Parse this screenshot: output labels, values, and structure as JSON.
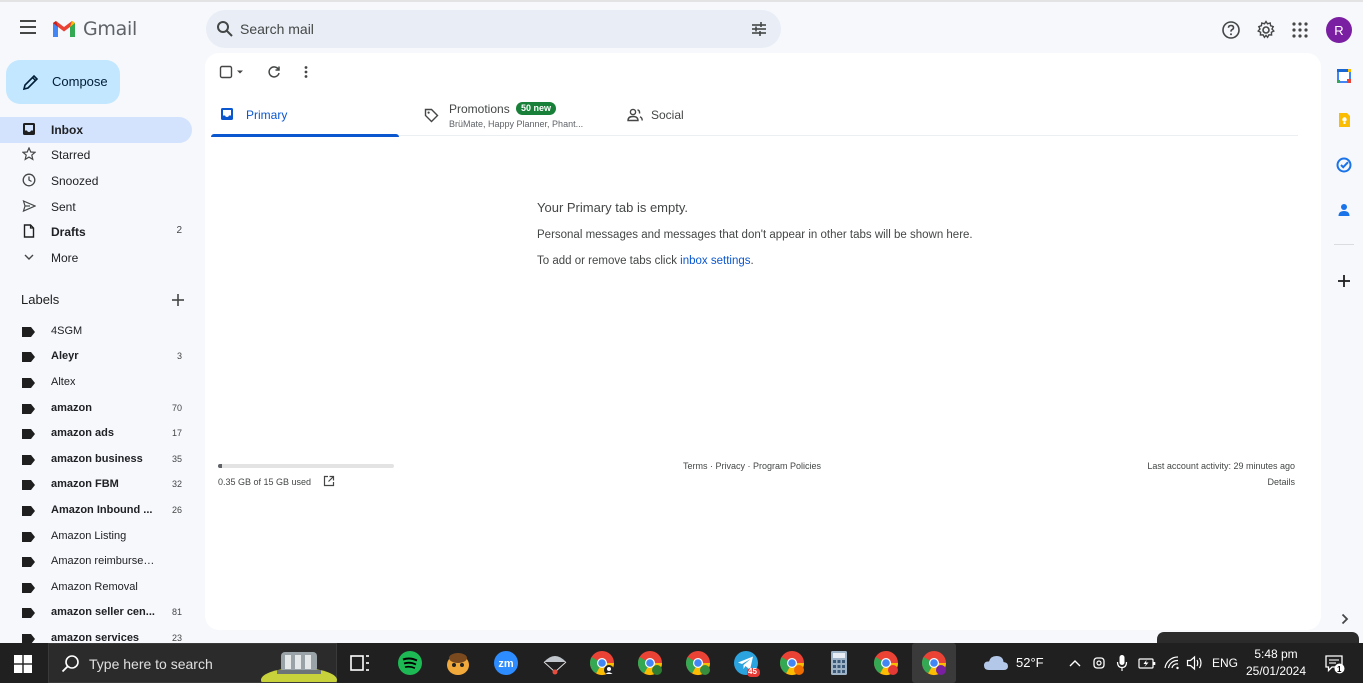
{
  "app": {
    "name": "Gmail",
    "avatar_letter": "R",
    "brand_colors": [
      "#ea4335",
      "#4285f4",
      "#34a853",
      "#fbbc04"
    ]
  },
  "search": {
    "placeholder": "Search mail"
  },
  "compose": {
    "label": "Compose"
  },
  "nav": [
    {
      "label": "Inbox",
      "count": "",
      "icon": "inbox-icon",
      "active": true,
      "bold": true
    },
    {
      "label": "Starred",
      "count": "",
      "icon": "star-icon",
      "active": false,
      "bold": false
    },
    {
      "label": "Snoozed",
      "count": "",
      "icon": "clock-icon",
      "active": false,
      "bold": false
    },
    {
      "label": "Sent",
      "count": "",
      "icon": "send-icon",
      "active": false,
      "bold": false
    },
    {
      "label": "Drafts",
      "count": "2",
      "icon": "draft-icon",
      "active": false,
      "bold": true
    },
    {
      "label": "More",
      "count": "",
      "icon": "chevron-down-icon",
      "active": false,
      "bold": false
    }
  ],
  "labels": {
    "header": "Labels",
    "items": [
      {
        "label": "4SGM",
        "count": "",
        "bold": false
      },
      {
        "label": "Aleyr",
        "count": "3",
        "bold": true
      },
      {
        "label": "Altex",
        "count": "",
        "bold": false
      },
      {
        "label": "amazon",
        "count": "70",
        "bold": true
      },
      {
        "label": "amazon ads",
        "count": "17",
        "bold": true
      },
      {
        "label": "amazon business",
        "count": "35",
        "bold": true
      },
      {
        "label": "amazon FBM",
        "count": "32",
        "bold": true
      },
      {
        "label": "Amazon Inbound ...",
        "count": "26",
        "bold": true
      },
      {
        "label": "Amazon Listing",
        "count": "",
        "bold": false
      },
      {
        "label": "Amazon reimbursement",
        "count": "",
        "bold": false
      },
      {
        "label": "Amazon Removal",
        "count": "",
        "bold": false
      },
      {
        "label": "amazon seller cen...",
        "count": "81",
        "bold": true
      },
      {
        "label": "amazon services",
        "count": "23",
        "bold": true
      }
    ]
  },
  "tabs": [
    {
      "label": "Primary",
      "icon": "inbox-tab-icon",
      "active": true,
      "sub": "",
      "badge": ""
    },
    {
      "label": "Promotions",
      "icon": "tag-icon",
      "active": false,
      "sub": "BrüMate, Happy Planner, Phant...",
      "badge": "50 new"
    },
    {
      "label": "Social",
      "icon": "people-icon",
      "active": false,
      "sub": "",
      "badge": ""
    }
  ],
  "empty_state": {
    "heading": "Your Primary tab is empty.",
    "line1": "Personal messages and messages that don't appear in other tabs will be shown here.",
    "line2_prefix": "To add or remove tabs click ",
    "line2_link": "inbox settings",
    "line2_suffix": "."
  },
  "footer": {
    "storage_text": "0.35 GB of 15 GB used",
    "storage_fraction": 0.023,
    "terms": "Terms",
    "privacy": "Privacy",
    "policies": "Program Policies",
    "sep": " · ",
    "activity": "Last account activity: 29 minutes ago",
    "details": "Details"
  },
  "taskbar": {
    "search_placeholder": "Type here to search",
    "weather": "52°F",
    "lang": "ENG",
    "time": "5:48 pm",
    "date": "25/01/2024",
    "notif_count": "1",
    "telegram_badge": "45",
    "chrome_badges": [
      "",
      "L",
      "M",
      "M",
      "",
      "R"
    ]
  }
}
